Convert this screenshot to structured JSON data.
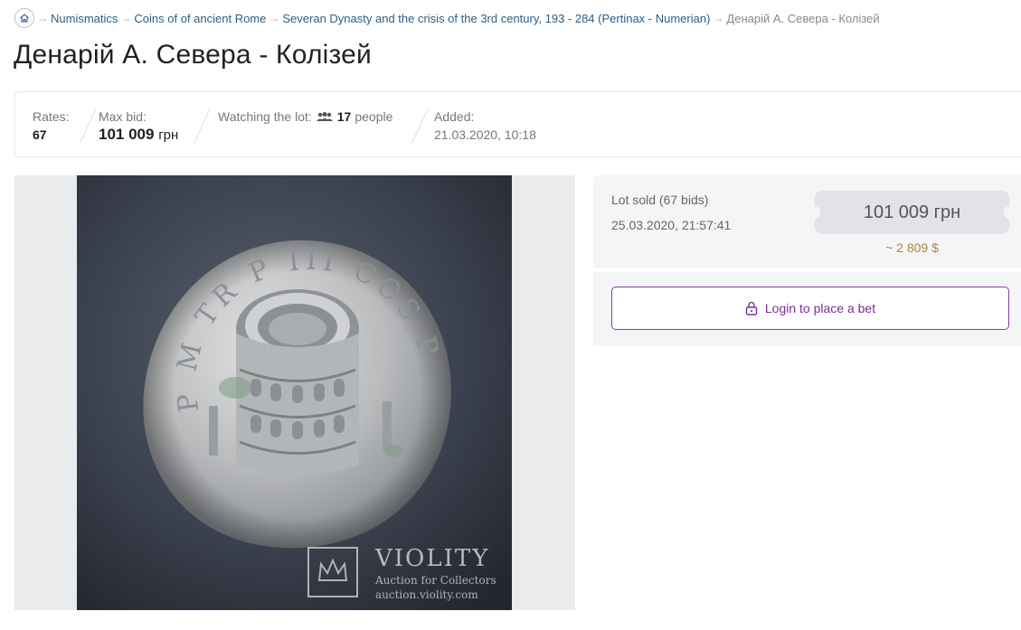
{
  "breadcrumb": {
    "items": [
      {
        "label": "Numismatics"
      },
      {
        "label": "Coins of of ancient Rome"
      },
      {
        "label": "Severan Dynasty and the crisis of the 3rd century, 193 - 284 (Pertinax - Numerian)"
      }
    ],
    "current": "Денарій А. Севера - Колізей",
    "separator": "→"
  },
  "title": "Денарій А. Севера - Колізей",
  "stats": {
    "rates_label": "Rates:",
    "rates_value": "67",
    "maxbid_label": "Max bid:",
    "maxbid_value": "101 009",
    "maxbid_unit": "грн",
    "watching_label": "Watching the lot:",
    "watching_icon": "people-icon",
    "watching_count": "17",
    "watching_suffix": "people",
    "added_label": "Added:",
    "added_value": "21.03.2020, 10:18"
  },
  "image": {
    "watermark_name": "VIOLITY",
    "watermark_tagline": "Auction for Collectors",
    "watermark_url": "auction.violity.com",
    "coin_legend": "P M TR P III COS P P"
  },
  "sold": {
    "label": "Lot sold (67 bids)",
    "date": "25.03.2020, 21:57:41",
    "price": "101 009 грн",
    "price_usd": "~ 2 809 $"
  },
  "login": {
    "label": "Login to place a bet",
    "icon": "lock-icon"
  },
  "colors": {
    "link": "#2a5f86",
    "accent": "#7b2e98",
    "usd": "#a88a3c"
  }
}
